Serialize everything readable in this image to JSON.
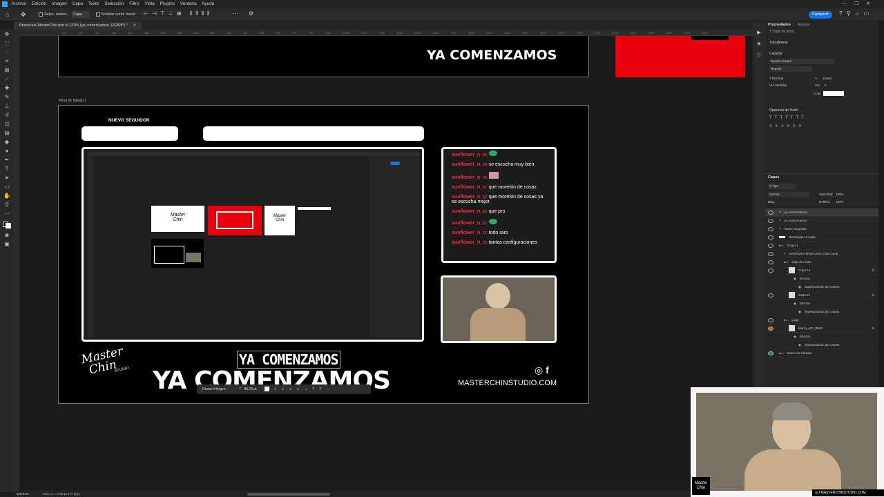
{
  "menu": [
    "Archivo",
    "Edición",
    "Imagen",
    "Capa",
    "Texto",
    "Selección",
    "Filtro",
    "Vista",
    "Plugins",
    "Ventana",
    "Ayuda"
  ],
  "options": {
    "auto_select": "Selec. autom.:",
    "layer": "Capa",
    "show_transform": "Mostrar contr. transf."
  },
  "share_button": "Compartir",
  "doc_tab": "Broadcast-MasterChin.psd al 120% (ya comenzamos, RGB/8*) *",
  "ruler_marks": "200 250 300 350 400 450 500 550 600 650 700 750 800 850 900 950 1000 1050 1100 1150 1200 1250 1300 1350 1400 1450 1500 1550 1600 1650 1700 1750 1800 1850 1900 1950 2000 2050",
  "status": {
    "zoom": "120,04%",
    "size": "4420 px x 2269 px (72 ppp)"
  },
  "canvas": {
    "top_board_title": "YA COMENZAMOS",
    "artboard_label": "Mesa de trabajo 1",
    "new_follower": "NUEVO SEGUIDOR",
    "logo_line1": "Master",
    "logo_line2": "Chin",
    "logo_studio": "STUDIO",
    "headline_small": "YA COMENZAMOS",
    "headline_big": "YA COMENZAMOS",
    "website": "MASTERCHINSTUDIO.COM",
    "inline_toolbar": {
      "font": "Devant Horgen",
      "size": "80.02 pt"
    }
  },
  "chat": [
    {
      "user": "sunflower_n_o:",
      "msg": "",
      "emote": true
    },
    {
      "user": "sunflower_n_o:",
      "msg": "se escucha muy bien"
    },
    {
      "user": "sunflower_n_o:",
      "msg": "",
      "emote": true
    },
    {
      "user": "sunflower_n_o:",
      "msg": "que moretón de cosaz"
    },
    {
      "user": "sunflower_n_o:",
      "msg": "que moretón de cosas ya"
    },
    {
      "user": "",
      "msg": "se escucha mejor"
    },
    {
      "user": "sunflower_n_o:",
      "msg": "que pro"
    },
    {
      "user": "sunflower_n_o:",
      "msg": "",
      "emote": true
    },
    {
      "user": "sunflower_n_o:",
      "msg": "todo raro"
    },
    {
      "user": "sunflower_n_o:",
      "msg": "tantas configuraciones"
    }
  ],
  "properties": {
    "tab": "Propiedades",
    "tab2": "Ajustes",
    "layer_type": "Capa de texto",
    "transform": "Transformar",
    "character": "Carácter",
    "font": "Devant Horgen",
    "style": "Regular",
    "size": "80.02 pt",
    "leading": "(Auto)",
    "kerning": "Medidas",
    "tracking": "0",
    "color_label": "Color",
    "text_options": "Opciones de Texto"
  },
  "layers": {
    "title": "Capas",
    "filter": "Tipo",
    "blend": "Normal",
    "opacity_label": "Opacidad:",
    "opacity": "100%",
    "lock_label": "Bloq.:",
    "fill_label": "Relleno:",
    "fill": "100%",
    "items": [
      {
        "name": "ya comenzamos",
        "indent": 0,
        "type": "T"
      },
      {
        "name": "ya comenzamos",
        "indent": 0,
        "type": "T"
      },
      {
        "name": "Nuevo Seguidor",
        "indent": 0,
        "type": "T"
      },
      {
        "name": "Rectángulo 4 copia",
        "indent": 0,
        "type": "rect"
      },
      {
        "name": "Grupo 1",
        "indent": 0,
        "type": "folder"
      },
      {
        "name": "MASTERCHINSTUDIO.COM copia",
        "indent": 1,
        "type": "T"
      },
      {
        "name": "Caja de redes",
        "indent": 1,
        "type": "folder"
      },
      {
        "name": "Capa 14",
        "indent": 2,
        "type": "img",
        "fx": "fx"
      },
      {
        "name": "Efectos",
        "indent": 3,
        "type": "sub"
      },
      {
        "name": "Superposición de colores",
        "indent": 4,
        "type": "sub"
      },
      {
        "name": "Capa 13",
        "indent": 2,
        "type": "img",
        "fx": "fx"
      },
      {
        "name": "Efectos",
        "indent": 3,
        "type": "sub"
      },
      {
        "name": "Superposición de colores",
        "indent": 4,
        "type": "sub"
      },
      {
        "name": "Logo",
        "indent": 1,
        "type": "folder"
      },
      {
        "name": "Marca_MC_Black",
        "indent": 2,
        "type": "img",
        "fx": "fx"
      },
      {
        "name": "Efectos",
        "indent": 3,
        "type": "sub"
      },
      {
        "name": "Superposición de colores",
        "indent": 4,
        "type": "sub"
      },
      {
        "name": "Marco de Cámara",
        "indent": 0,
        "type": "folder"
      }
    ]
  },
  "webcam_overlay": {
    "site": "MASTERCHINSTUDIO.COM"
  },
  "colors": {
    "red": "#e8000d",
    "accent": "#1473e6"
  }
}
